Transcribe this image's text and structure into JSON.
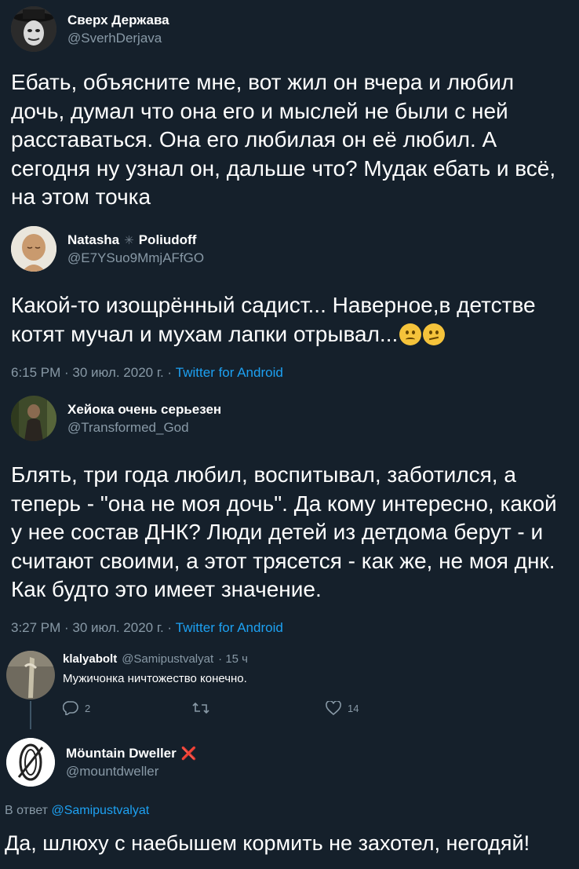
{
  "tweet1": {
    "name": "Сверх Держава",
    "handle": "@SverhDerjava",
    "text": "Ебать, объясните мне, вот жил он вчера и любил дочь, думал что она его и мыслей не были с ней расставаться. Она его любилая он её любил. А сегодня ну узнал он, дальше что? Мудак ебать и всё, на этом точка"
  },
  "tweet2": {
    "name_part1": "Natasha",
    "name_sep": "✳",
    "name_part2": "Poliudoff",
    "handle": "@E7YSuo9MmjAFfGO",
    "text": "Какой-то изощрённый садист... Наверное,в детстве котят мучал и мухам лапки отрывал...",
    "time": "6:15 PM · 30 июл. 2020 г. · ",
    "source": "Twitter for Android",
    "emoji": [
      "frowning-face-emoji",
      "confused-face-emoji"
    ]
  },
  "tweet3": {
    "name": "Хейока очень серьезен",
    "handle": "@Transformed_God",
    "text": "Блять, три года любил, воспитывал, заботился, а теперь - \"она не моя дочь\". Да кому интересно, какой у нее состав ДНК? Люди детей из детдома берут - и считают своими, а этот трясется - как же, не моя днк. Как будто это имеет значение.",
    "time": "3:27 PM · 30 июл. 2020 г. · ",
    "source": "Twitter for Android"
  },
  "tweet4": {
    "name": "klalyabolt",
    "handle": "@Samipustvalyat",
    "age": "· 15 ч",
    "text": "Мужичонка ничтожество конечно.",
    "replies": "2",
    "likes": "14"
  },
  "tweet5": {
    "name": "Möuntain Dweller",
    "badge": "❌",
    "handle": "@mountdweller",
    "in_reply_prefix": "В ответ ",
    "in_reply_mention": "@Samipustvalyat",
    "text": "Да, шлюху с наебышем кормить не захотел, негодяй!"
  },
  "colors": {
    "background": "#15202b",
    "secondary_text": "#8899a6",
    "link": "#1da1f2",
    "badge_red": "#e0245e"
  }
}
